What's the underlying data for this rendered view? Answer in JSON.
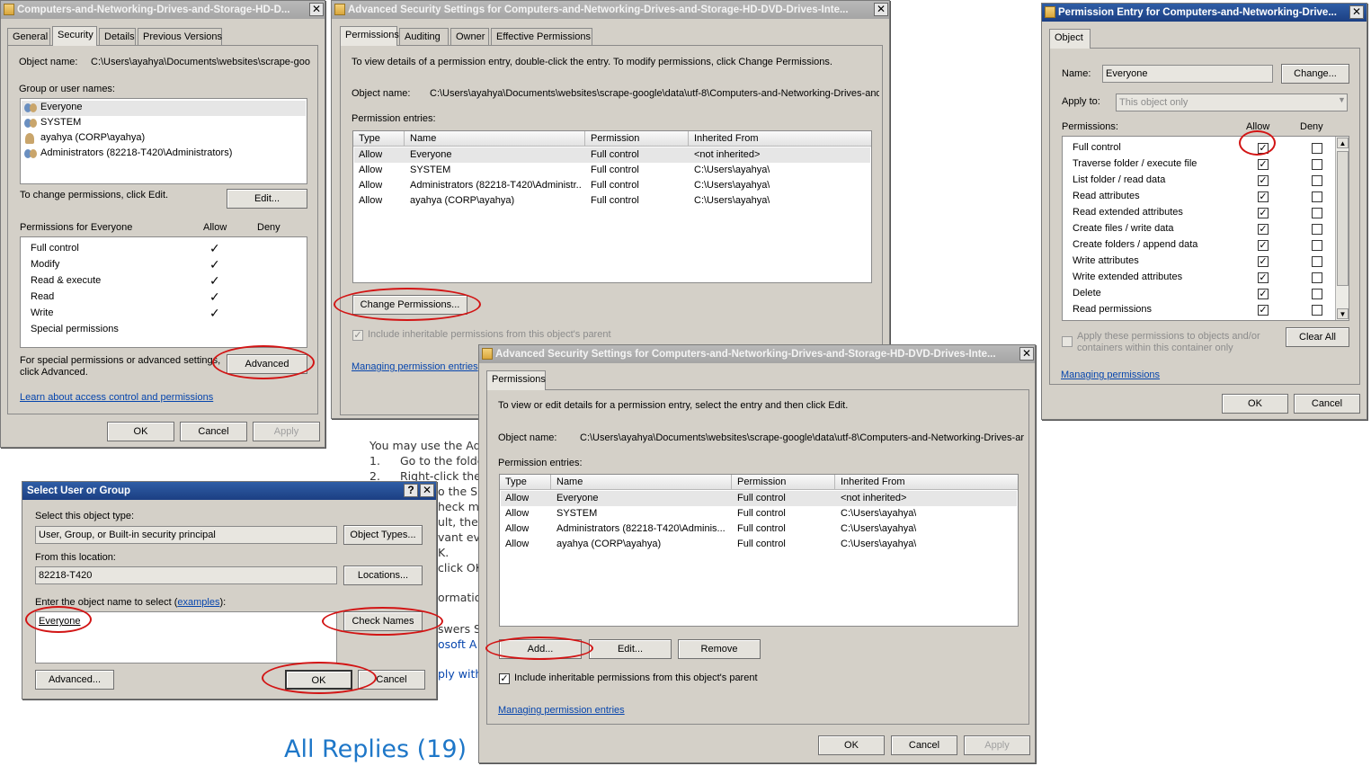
{
  "properties": {
    "title": "Computers-and-Networking-Drives-and-Storage-HD-D...",
    "close": "✕",
    "tabs": [
      "General",
      "Security",
      "Details",
      "Previous Versions"
    ],
    "object_name_label": "Object name:",
    "object_name_value": "C:\\Users\\ayahya\\Documents\\websites\\scrape-goo",
    "group_label": "Group or user names:",
    "users": [
      "Everyone",
      "SYSTEM",
      "ayahya (CORP\\ayahya)",
      "Administrators (82218-T420\\Administrators)"
    ],
    "change_text": "To change permissions, click Edit.",
    "edit_button": "Edit...",
    "perm_for": "Permissions for Everyone",
    "allow_col": "Allow",
    "deny_col": "Deny",
    "permissions": [
      "Full control",
      "Modify",
      "Read & execute",
      "Read",
      "Write",
      "Special permissions"
    ],
    "check": "✓",
    "special_text_1": "For special permissions or advanced settings,",
    "special_text_2": "click Advanced.",
    "advanced_button": "Advanced",
    "learn_link": "Learn about access control and permissions",
    "ok": "OK",
    "cancel": "Cancel",
    "apply": "Apply"
  },
  "adv1": {
    "title": "Advanced Security Settings for Computers-and-Networking-Drives-and-Storage-HD-DVD-Drives-Inte...",
    "close": "✕",
    "tabs": [
      "Permissions",
      "Auditing",
      "Owner",
      "Effective Permissions"
    ],
    "intro": "To view details of a permission entry, double-click the entry. To modify permissions, click Change Permissions.",
    "object_name_label": "Object name:",
    "object_name_value": "C:\\Users\\ayahya\\Documents\\websites\\scrape-google\\data\\utf-8\\Computers-and-Networking-Drives-and",
    "entries_label": "Permission entries:",
    "headers": [
      "Type",
      "Name",
      "Permission",
      "Inherited From"
    ],
    "rows": [
      [
        "Allow",
        "Everyone",
        "Full control",
        "<not inherited>"
      ],
      [
        "Allow",
        "SYSTEM",
        "Full control",
        "C:\\Users\\ayahya\\"
      ],
      [
        "Allow",
        "Administrators (82218-T420\\Administr...",
        "Full control",
        "C:\\Users\\ayahya\\"
      ],
      [
        "Allow",
        "ayahya (CORP\\ayahya)",
        "Full control",
        "C:\\Users\\ayahya\\"
      ]
    ],
    "change_button": "Change Permissions...",
    "include_label": "Include inheritable permissions from this object's parent",
    "managing_link": "Managing permission entries"
  },
  "adv2": {
    "title": "Advanced Security Settings for Computers-and-Networking-Drives-and-Storage-HD-DVD-Drives-Inte...",
    "close": "✕",
    "tab": "Permissions",
    "intro": "To view or edit details for a permission entry, select the entry and then click Edit.",
    "object_name_label": "Object name:",
    "object_name_value": "C:\\Users\\ayahya\\Documents\\websites\\scrape-google\\data\\utf-8\\Computers-and-Networking-Drives-ar",
    "entries_label": "Permission entries:",
    "headers": [
      "Type",
      "Name",
      "Permission",
      "Inherited From"
    ],
    "rows": [
      [
        "Allow",
        "Everyone",
        "Full control",
        "<not inherited>"
      ],
      [
        "Allow",
        "SYSTEM",
        "Full control",
        "C:\\Users\\ayahya\\"
      ],
      [
        "Allow",
        "Administrators (82218-T420\\Adminis...",
        "Full control",
        "C:\\Users\\ayahya\\"
      ],
      [
        "Allow",
        "ayahya (CORP\\ayahya)",
        "Full control",
        "C:\\Users\\ayahya\\"
      ]
    ],
    "add_button": "Add...",
    "edit_button": "Edit...",
    "remove_button": "Remove",
    "include_label": "Include inheritable permissions from this object's parent",
    "managing_link": "Managing permission entries",
    "ok": "OK",
    "cancel": "Cancel",
    "apply": "Apply"
  },
  "entry": {
    "title": "Permission Entry for Computers-and-Networking-Drive...",
    "close": "✕",
    "tab": "Object",
    "name_label": "Name:",
    "name_value": "Everyone",
    "change_button": "Change...",
    "apply_to_label": "Apply to:",
    "apply_to_value": "This object only",
    "permissions_label": "Permissions:",
    "allow_col": "Allow",
    "deny_col": "Deny",
    "permissions": [
      "Full control",
      "Traverse folder / execute file",
      "List folder / read data",
      "Read attributes",
      "Read extended attributes",
      "Create files / write data",
      "Create folders / append data",
      "Write attributes",
      "Write extended attributes",
      "Delete",
      "Read permissions"
    ],
    "apply_text_1": "Apply these permissions to objects and/or",
    "apply_text_2": "containers within this container only",
    "clear_button": "Clear All",
    "managing_link": "Managing permissions",
    "ok": "OK",
    "cancel": "Cancel"
  },
  "select": {
    "title": "Select User or Group",
    "help": "?",
    "close": "✕",
    "object_type_label": "Select this object type:",
    "object_type_value": "User, Group, or Built-in security principal",
    "object_types_button": "Object Types...",
    "location_label": "From this location:",
    "location_value": "82218-T420",
    "locations_button": "Locations...",
    "enter_label": "Enter the object name to select (",
    "examples_link": "examples",
    "enter_label_end": "):",
    "name_value": "Everyone",
    "check_names_button": "Check Names",
    "advanced_button": "Advanced...",
    "ok": "OK",
    "cancel": "Cancel"
  },
  "page": {
    "line1": "You may use the Adv",
    "line2a": "1.",
    "line2b": "Go to the folde",
    "line3a": "2.",
    "line3b": "Right-click the",
    "frag1": "o the S",
    "frag2": "heck ma",
    "frag3": "ult, ther",
    "frag4": "vant eve",
    "frag5": "K.",
    "frag6": "click OK",
    "frag7": "ormatio",
    "frag8": "swers S",
    "frag9": "osoft A",
    "frag10": "ply with",
    "all_replies": "All Replies (19)"
  }
}
